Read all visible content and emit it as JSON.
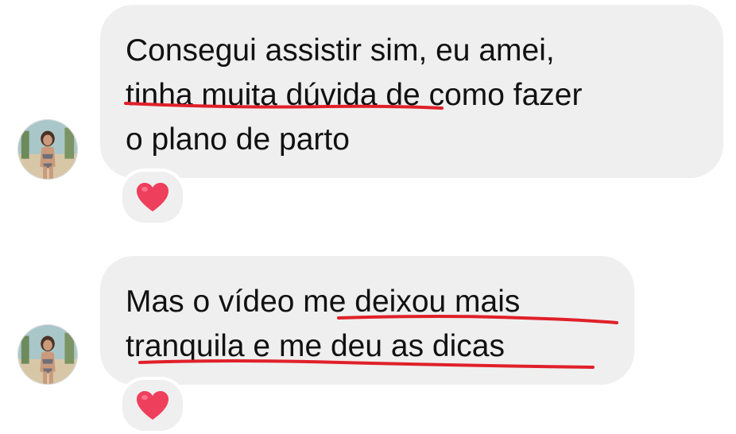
{
  "messages": [
    {
      "lines": [
        "Consegui assistir sim, eu amei,",
        "tinha muita dúvida de como fazer",
        "o plano de parto"
      ],
      "reaction": "heart-icon"
    },
    {
      "lines": [
        "Mas o vídeo me deixou mais",
        "tranquila e me deu as dicas"
      ],
      "reaction": "heart-icon"
    }
  ],
  "colors": {
    "bubble": "#efefef",
    "text": "#111111",
    "underline": "#e0202a",
    "heart": "#ee3f5c"
  }
}
